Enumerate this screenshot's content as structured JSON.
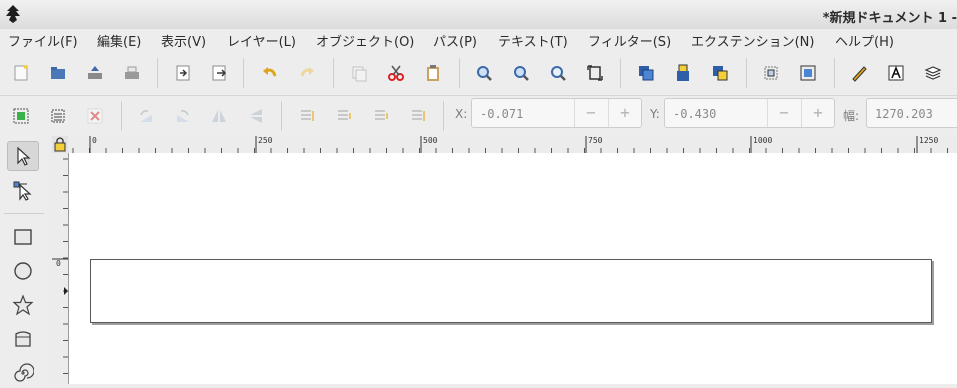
{
  "window": {
    "title": "*新規ドキュメント 1 -"
  },
  "menu": [
    {
      "label": "ファイル(F)"
    },
    {
      "label": "編集(E)"
    },
    {
      "label": "表示(V)"
    },
    {
      "label": "レイヤー(L)"
    },
    {
      "label": "オブジェクト(O)"
    },
    {
      "label": "パス(P)"
    },
    {
      "label": "テキスト(T)"
    },
    {
      "label": "フィルター(S)"
    },
    {
      "label": "エクステンション(N)"
    },
    {
      "label": "ヘルプ(H)"
    }
  ],
  "toolbar": {
    "buttons": [
      {
        "icon": "new-document-icon"
      },
      {
        "icon": "open-icon"
      },
      {
        "icon": "save-icon"
      },
      {
        "icon": "print-icon"
      },
      {
        "icon": "import-icon"
      },
      {
        "icon": "export-icon"
      },
      {
        "icon": "undo-icon"
      },
      {
        "icon": "redo-icon"
      },
      {
        "icon": "copy-icon"
      },
      {
        "icon": "cut-icon"
      },
      {
        "icon": "paste-icon"
      },
      {
        "icon": "zoom-in-icon"
      },
      {
        "icon": "zoom-out-icon"
      },
      {
        "icon": "zoom-fit-icon"
      },
      {
        "icon": "zoom-page-icon"
      },
      {
        "icon": "duplicate-icon"
      },
      {
        "icon": "clone-icon"
      },
      {
        "icon": "unlink-clone-icon"
      },
      {
        "icon": "group-icon"
      },
      {
        "icon": "ungroup-icon"
      },
      {
        "icon": "fill-stroke-icon"
      },
      {
        "icon": "text-font-icon"
      },
      {
        "icon": "layers-icon"
      }
    ]
  },
  "coords": {
    "x_label": "X:",
    "x_value": "-0.071",
    "y_label": "Y:",
    "y_value": "-0.430",
    "w_label": "幅:",
    "w_value": "1270.203",
    "minus": "−",
    "plus": "+"
  },
  "ruler": {
    "h_labels": [
      "0",
      "250",
      "500",
      "750",
      "1000",
      "1250"
    ],
    "v_labels": [
      "0"
    ]
  },
  "tools": [
    {
      "icon": "selector-arrow-icon",
      "active": true
    },
    {
      "icon": "node-edit-icon"
    },
    {
      "icon": "rectangle-icon"
    },
    {
      "icon": "circle-icon"
    },
    {
      "icon": "star-icon"
    },
    {
      "icon": "3d-box-icon"
    },
    {
      "icon": "spiral-icon"
    }
  ]
}
